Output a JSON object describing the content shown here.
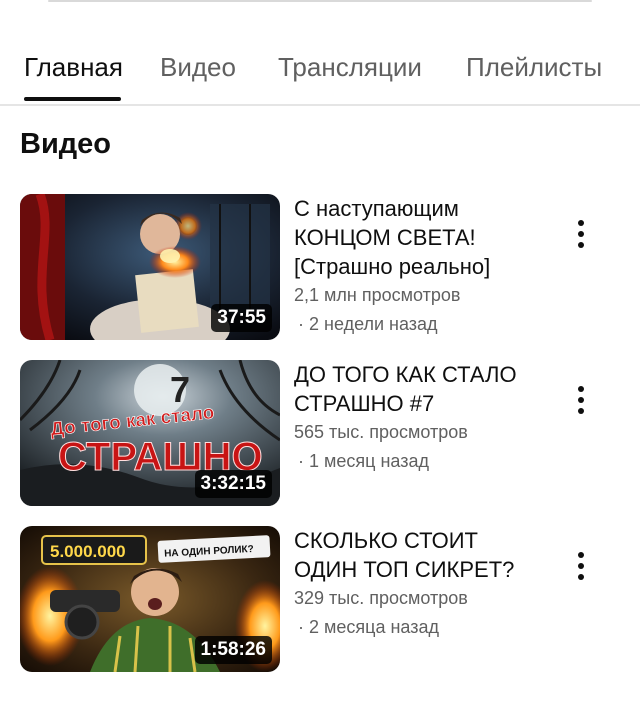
{
  "tabs": [
    {
      "label": "Главная",
      "active": true
    },
    {
      "label": "Видео",
      "active": false
    },
    {
      "label": "Трансляции",
      "active": false
    },
    {
      "label": "Плейлисты",
      "active": false
    }
  ],
  "section": {
    "title": "Видео"
  },
  "videos": [
    {
      "title_lines": [
        "С наступающим",
        "КОНЦОМ СВЕТА!",
        "[Страшно реально]"
      ],
      "views": "2,1 млн просмотров",
      "age": "· 2 недели назад",
      "duration": "37:55"
    },
    {
      "title_lines": [
        "ДО ТОГО КАК СТАЛО",
        "СТРАШНО #7"
      ],
      "views": "565 тыс. просмотров",
      "age": "· 1 месяц назад",
      "duration": "3:32:15",
      "thumb_text": [
        "До того как стало",
        "СТРАШНО",
        "7"
      ]
    },
    {
      "title_lines": [
        "СКОЛЬКО СТОИТ",
        "ОДИН ТОП СИКРЕТ?"
      ],
      "views": "329 тыс. просмотров",
      "age": "· 2 месяца назад",
      "duration": "1:58:26",
      "thumb_text": [
        "5.000.000",
        "НА ОДИН РОЛИК?"
      ]
    }
  ],
  "colors": {
    "text": "#0f0f0f",
    "secondary": "#606060",
    "divider": "#e5e5e5"
  }
}
